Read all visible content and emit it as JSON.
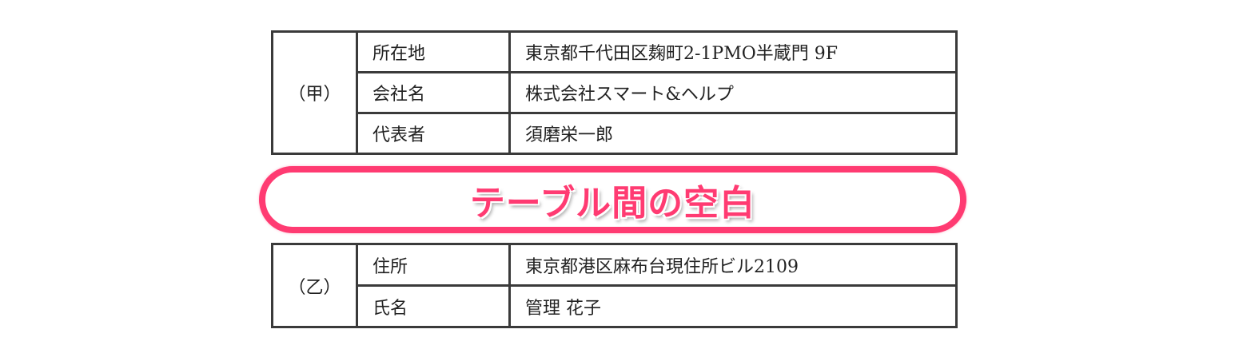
{
  "party_a": {
    "label": "（甲）",
    "rows": [
      {
        "label": "所在地",
        "value": "東京都千代田区麹町2-1PMO半蔵門 9F"
      },
      {
        "label": "会社名",
        "value": "株式会社スマート&ヘルプ"
      },
      {
        "label": "代表者",
        "value": "須磨栄一郎"
      }
    ]
  },
  "callout": {
    "text": "テーブル間の空白",
    "color": "#ff3b72"
  },
  "party_b": {
    "label": "（乙）",
    "rows": [
      {
        "label": "住所",
        "value": "東京都港区麻布台現住所ビル2109"
      },
      {
        "label": "氏名",
        "value": "管理 花子"
      }
    ]
  }
}
